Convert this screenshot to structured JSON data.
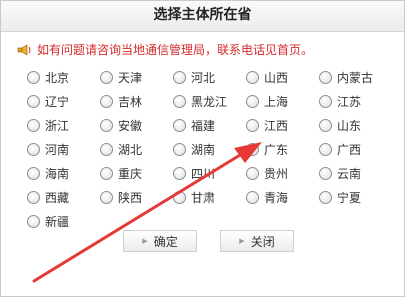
{
  "dialog": {
    "title": "选择主体所在省",
    "notice": "如有问题请咨询当地通信管理局，联系电话见首页。"
  },
  "provinces": [
    "北京",
    "天津",
    "河北",
    "山西",
    "内蒙古",
    "辽宁",
    "吉林",
    "黑龙江",
    "上海",
    "江苏",
    "浙江",
    "安徽",
    "福建",
    "江西",
    "山东",
    "河南",
    "湖北",
    "湖南",
    "广东",
    "广西",
    "海南",
    "重庆",
    "四川",
    "贵州",
    "云南",
    "西藏",
    "陕西",
    "甘肃",
    "青海",
    "宁夏",
    "新疆"
  ],
  "buttons": {
    "confirm": "确定",
    "close": "关闭"
  },
  "colors": {
    "notice_text": "#d42b2b",
    "annotation_arrow": "#e53935"
  },
  "icons": {
    "notice": "speaker-icon",
    "button_bullet": "triangle-right-icon"
  }
}
